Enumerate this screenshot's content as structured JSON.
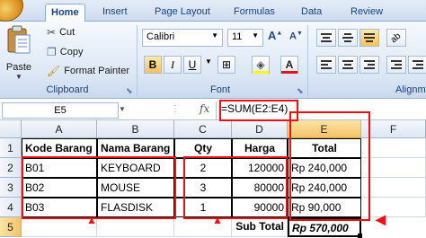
{
  "ribbon": {
    "tabs": [
      "Home",
      "Insert",
      "Page Layout",
      "Formulas",
      "Data",
      "Review"
    ],
    "active_tab": "Home",
    "clipboard": {
      "paste": "Paste",
      "cut": "Cut",
      "copy": "Copy",
      "format_painter": "Format Painter",
      "group": "Clipboard"
    },
    "font": {
      "name": "Calibri",
      "size": "11",
      "bold": "B",
      "italic": "I",
      "underline": "U",
      "group": "Font"
    },
    "alignment_group": "Alignm"
  },
  "formula_bar": {
    "name_box": "E5",
    "fx": "fx",
    "formula": "=SUM(E2:E4)"
  },
  "sheet": {
    "columns": [
      "A",
      "B",
      "C",
      "D",
      "E",
      "F"
    ],
    "rows": [
      "1",
      "2",
      "3",
      "4",
      "5"
    ],
    "selected_col": "E",
    "selected_row": "5",
    "header": [
      "Kode Barang",
      "Nama Barang",
      "Qty",
      "Harga",
      "Total"
    ],
    "data": [
      [
        "B01",
        "KEYBOARD",
        "2",
        "120000",
        "Rp 240,000"
      ],
      [
        "B02",
        "MOUSE",
        "3",
        "80000",
        "Rp 240,000"
      ],
      [
        "B03",
        "FLASDISK",
        "1",
        "90000",
        "Rp 90,000"
      ]
    ],
    "subtotal_label": "Sub Total",
    "subtotal_value": "Rp 570,000"
  },
  "colors": {
    "annotation": "#ee1111",
    "ribbon_blue": "#15428b",
    "selection": "#f5c36a"
  }
}
